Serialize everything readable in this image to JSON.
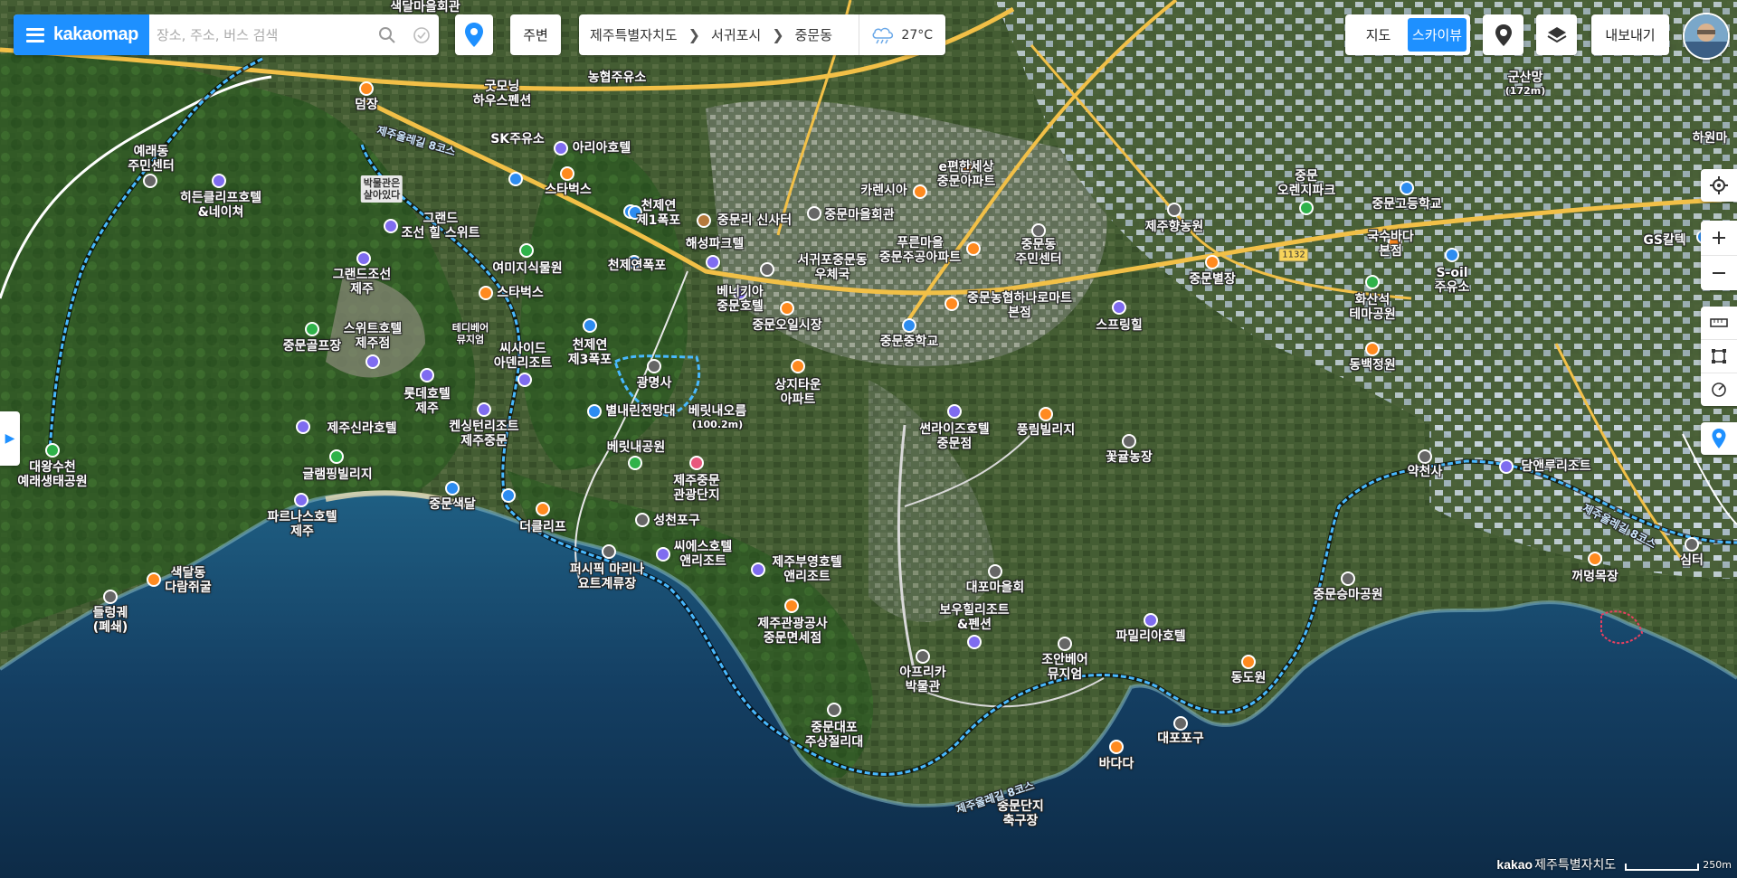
{
  "header": {
    "logo": "kakaomap",
    "search_placeholder": "장소, 주소, 버스 검색",
    "nearby_label": "주변",
    "breadcrumb": [
      "제주특별자치도",
      "서귀포시",
      "중문동"
    ],
    "weather": "27°C",
    "map_types": [
      "지도",
      "스카이뷰"
    ],
    "active_map_type": "스카이뷰",
    "export_label": "내보내기"
  },
  "icons": {
    "menu": "menu-icon",
    "search": "search-icon",
    "check": "check-circle-icon",
    "pin": "location-pin-icon",
    "weather": "rain-cloud-icon",
    "roadview": "roadview-icon",
    "layers": "layers-icon",
    "locate": "crosshair-icon",
    "zoom_in": "plus-icon",
    "zoom_out": "minus-icon",
    "ruler": "ruler-icon",
    "area": "area-icon",
    "radius": "radius-icon",
    "marker": "marker-icon",
    "sidebar": "chevron-right-icon"
  },
  "colors": {
    "accent": "#1e90ff",
    "sea": "#14406b",
    "land": "#3f5d2c",
    "road": "#f4c04a",
    "trail": "#43b7ff"
  },
  "footer": {
    "brand": "kakao",
    "region": "제주특별자치도",
    "scale": "250m"
  },
  "map": {
    "labels": [
      {
        "t": "색달마을회관"
      },
      {
        "t": "굿모닝\n하우스펜션"
      },
      {
        "t": "농협주유소"
      },
      {
        "t": "덤장"
      },
      {
        "t": "예래동\n주민센터"
      },
      {
        "t": "SK주유소"
      },
      {
        "t": "아리아호텔"
      },
      {
        "t": "박물관은\n살아있다"
      },
      {
        "t": "히든클리프호텔\n&네이쳐"
      },
      {
        "t": "스타벅스"
      },
      {
        "t": "천제연\n제1폭포"
      },
      {
        "t": "중문리 신사터"
      },
      {
        "t": "그랜드\n조선 힐 스위트"
      },
      {
        "t": "해성파크텔"
      },
      {
        "t": "서귀포중문동\n우체국"
      },
      {
        "t": "천제연폭포"
      },
      {
        "t": "여미지식물원"
      },
      {
        "t": "그랜드조선\n제주"
      },
      {
        "t": "스타벅스"
      },
      {
        "t": "베니키아\n중문호텔"
      },
      {
        "t": "중문오일시장"
      },
      {
        "t": "테디베어\n뮤지엄"
      },
      {
        "t": "스위트호텔\n제주점"
      },
      {
        "t": "중문골프장"
      },
      {
        "t": "씨사이드\n아덴리조트"
      },
      {
        "t": "천제연\n제3폭포"
      },
      {
        "t": "광명사"
      },
      {
        "t": "롯데호텔\n제주"
      },
      {
        "t": "상지타운\n아파트"
      },
      {
        "t": "별내린전망대"
      },
      {
        "t": "베릿내오름"
      },
      {
        "t": "(100.2m)"
      },
      {
        "t": "켄싱턴리조트\n제주중문"
      },
      {
        "t": "제주신라호텔"
      },
      {
        "t": "대왕수천\n예래생태공원"
      },
      {
        "t": "베릿내공원"
      },
      {
        "t": "제주중문\n관광단지"
      },
      {
        "t": "글램핑빌리지"
      },
      {
        "t": "중문색달"
      },
      {
        "t": "성천포구"
      },
      {
        "t": "파르나스호텔\n제주"
      },
      {
        "t": "더클리프"
      },
      {
        "t": "씨에스호텔\n앤리조트"
      },
      {
        "t": "색달동\n다람쥐굴"
      },
      {
        "t": "퍼시픽 마리나\n요트계류장"
      },
      {
        "t": "제주부영호텔\n앤리조트"
      },
      {
        "t": "들렁궤\n(폐쇄)"
      },
      {
        "t": "제주관광공사\n중문면세점"
      },
      {
        "t": "대포마을회"
      },
      {
        "t": "보우힐리조트\n&펜션"
      },
      {
        "t": "아프리카\n박물관"
      },
      {
        "t": "조안베어\n뮤지엄"
      },
      {
        "t": "파밀리아호텔"
      },
      {
        "t": "중문대포\n주상절리대"
      },
      {
        "t": "동도원"
      },
      {
        "t": "대포포구"
      },
      {
        "t": "바다다"
      },
      {
        "t": "중문단지\n축구장"
      },
      {
        "t": "카렌시아"
      },
      {
        "t": "e편한세상\n중문아파트"
      },
      {
        "t": "중문마을회관"
      },
      {
        "t": "푸른마을\n중문주공아파트"
      },
      {
        "t": "중문동\n주민센터"
      },
      {
        "t": "중문농협하나로마트\n본점"
      },
      {
        "t": "중문중학교"
      },
      {
        "t": "스프링힐"
      },
      {
        "t": "썬라이즈호텔\n중문점"
      },
      {
        "t": "풍림빌리지"
      },
      {
        "t": "꽃귤농장"
      },
      {
        "t": "제주향농원"
      },
      {
        "t": "중문\n오렌지파크"
      },
      {
        "t": "중문고등학교"
      },
      {
        "t": "국수바다\n본점"
      },
      {
        "t": "중문별장"
      },
      {
        "t": "화산석\n테마공원"
      },
      {
        "t": "S-oil\n주유소"
      },
      {
        "t": "동백정원"
      },
      {
        "t": "약천사"
      },
      {
        "t": "담앤루리조트"
      },
      {
        "t": "중문승마공원"
      },
      {
        "t": "꺼멍목장"
      },
      {
        "t": "심터"
      },
      {
        "t": "GS칼텍"
      },
      {
        "t": "군산망"
      },
      {
        "t": "(172m)"
      },
      {
        "t": "하원마"
      },
      {
        "t": "제주올레길 8코스"
      },
      {
        "t": "제주올레길 8코스"
      },
      {
        "t": "제주올레길 8코스"
      },
      {
        "t": "1132"
      }
    ]
  }
}
